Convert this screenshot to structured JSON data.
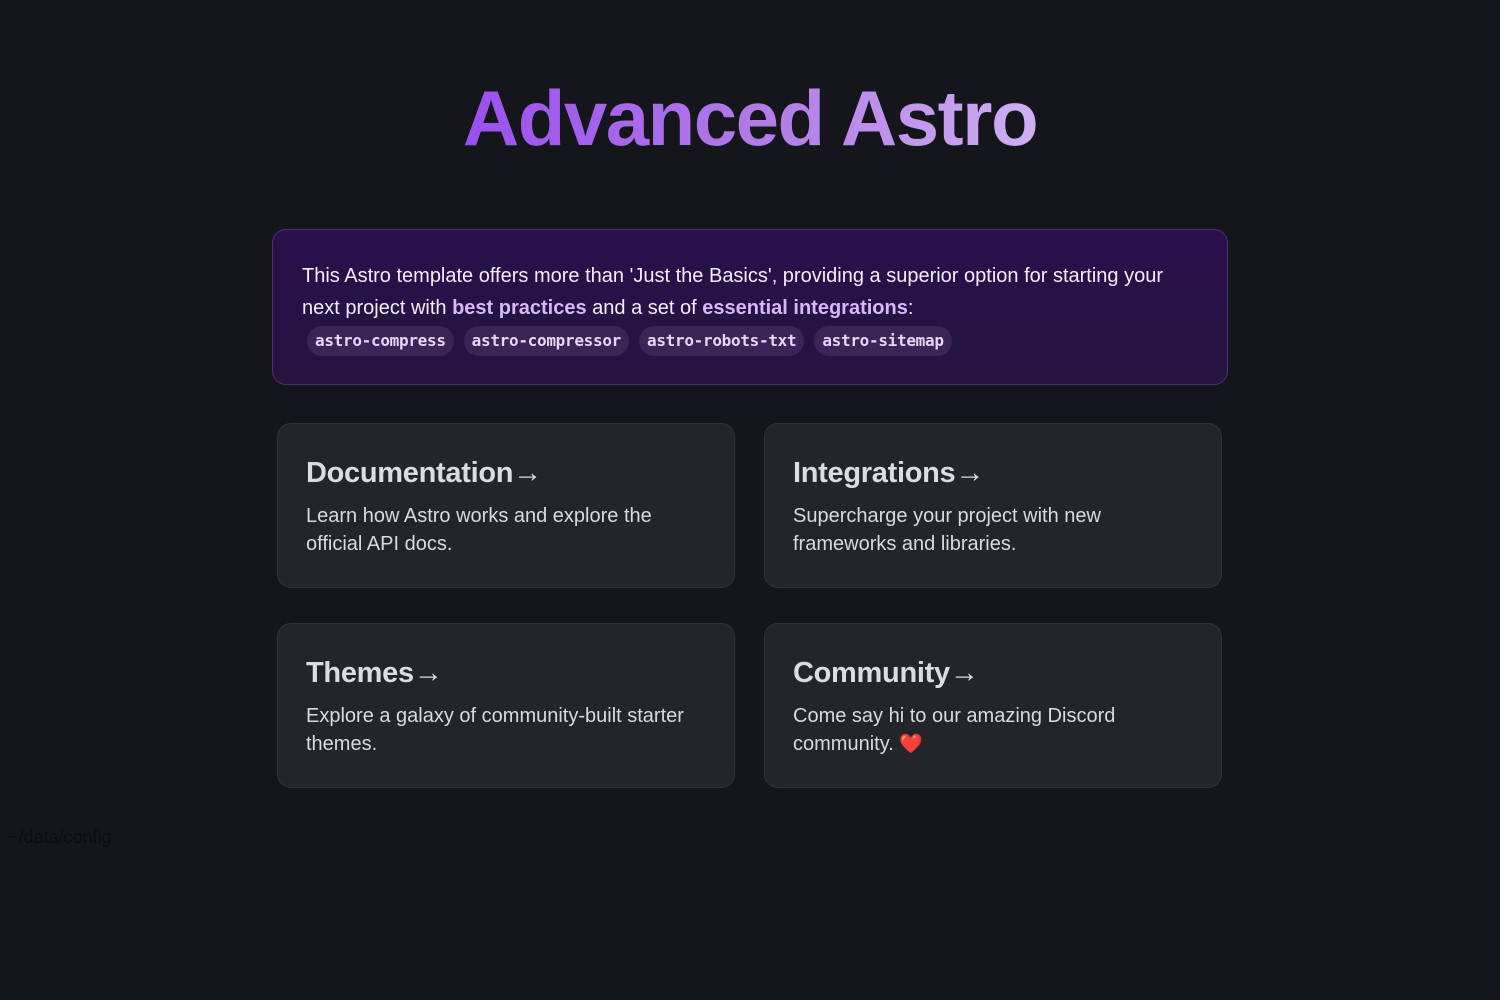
{
  "header": {
    "title": "Advanced Astro"
  },
  "intro": {
    "text_start": "This Astro template offers more than 'Just the Basics', providing a superior option for starting your next project with ",
    "highlight_1": "best practices",
    "text_mid": " and a set of ",
    "highlight_2": "essential integrations",
    "text_end": ":",
    "integrations": [
      "astro-compress",
      "astro-compressor",
      "astro-robots-txt",
      "astro-sitemap"
    ]
  },
  "cards": [
    {
      "title": "Documentation",
      "arrow": "→",
      "body": "Learn how Astro works and explore the official API docs."
    },
    {
      "title": "Integrations",
      "arrow": "→",
      "body": "Supercharge your project with new frameworks and libraries."
    },
    {
      "title": "Themes",
      "arrow": "→",
      "body": "Explore a galaxy of community-built starter themes."
    },
    {
      "title": "Community",
      "arrow": "→",
      "body": "Come say hi to our amazing Discord community.",
      "emoji": "❤️"
    }
  ],
  "footer": {
    "path": "~/data/config"
  },
  "colors": {
    "background": "#15161b",
    "title_gradient_start": "#9b4fef",
    "title_gradient_end": "#cfb0f2",
    "instructions_bg": "#2a0f4d",
    "card_bg": "#23252b",
    "highlight": "#d6b8f6",
    "heart": "#e32636"
  }
}
